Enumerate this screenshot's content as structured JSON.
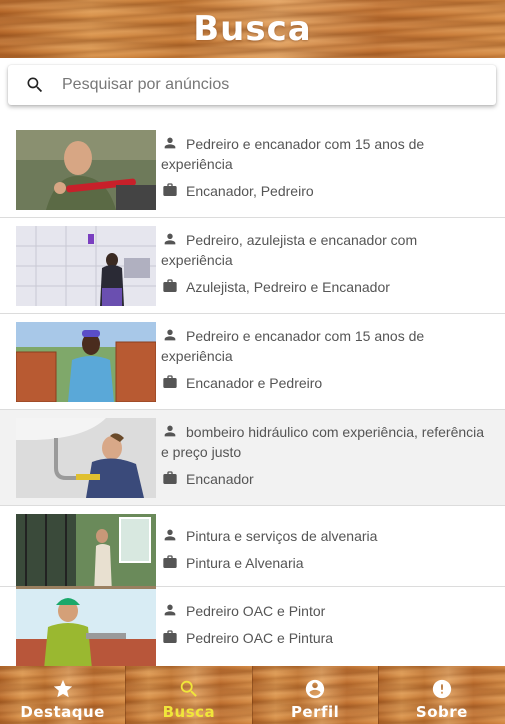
{
  "header": {
    "title": "Busca"
  },
  "search": {
    "placeholder": "Pesquisar por anúncios",
    "icon": "search-icon"
  },
  "listings": [
    {
      "title": "Pedreiro e encanador com 15 anos de experiência",
      "category": "Encanador, Pedreiro",
      "selected": false
    },
    {
      "title": "Pedreiro, azulejista e encanador com experiência",
      "category": "Azulejista, Pedreiro e Encanador",
      "selected": false
    },
    {
      "title": "Pedreiro e encanador com 15 anos de experiência",
      "category": "Encanador e Pedreiro",
      "selected": false
    },
    {
      "title": "bombeiro hidráulico com experiência, referência e preço justo",
      "category": "Encanador",
      "selected": true
    },
    {
      "title": "Pintura e serviços de alvenaria",
      "category": "Pintura e Alvenaria",
      "selected": false
    },
    {
      "title": "Pedreiro OAC e Pintor",
      "category": "Pedreiro OAC e Pintura",
      "selected": false
    }
  ],
  "nav": {
    "tabs": [
      {
        "label": "Destaque",
        "icon": "star-icon",
        "active": false
      },
      {
        "label": "Busca",
        "icon": "search-icon",
        "active": true
      },
      {
        "label": "Perfil",
        "icon": "account-circle-icon",
        "active": false
      },
      {
        "label": "Sobre",
        "icon": "info-icon",
        "active": false
      }
    ]
  },
  "colors": {
    "active_tab": "#f0e63a",
    "text": "#555555",
    "wood": "#c87a35"
  }
}
